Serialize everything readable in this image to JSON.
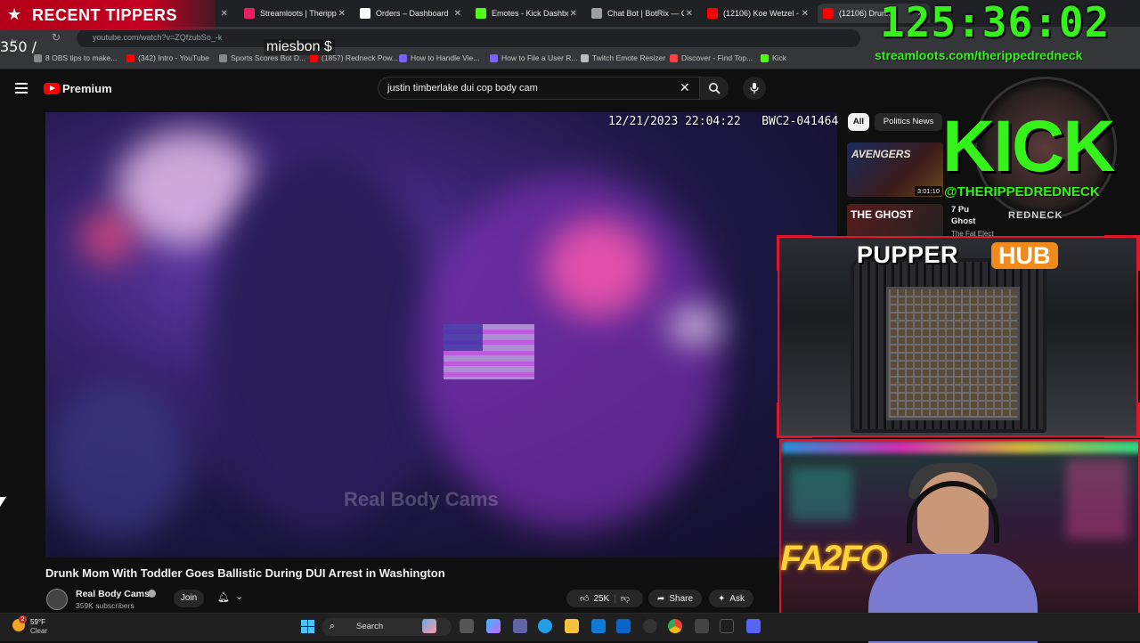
{
  "browser": {
    "tabs": [
      {
        "label": "",
        "color": "#c0392b"
      },
      {
        "label": "Streamloots | Therippe",
        "color": "#e91e63"
      },
      {
        "label": "Orders – Dashboard",
        "color": "#ffffff"
      },
      {
        "label": "Emotes - Kick Dashbo",
        "color": "#53fc18"
      },
      {
        "label": "Chat Bot | BotRix — Cl",
        "color": "#9aa0a6"
      },
      {
        "label": "(12106) Koe Wetzel - S",
        "color": "#ff0000"
      },
      {
        "label": "(12106) Drunk",
        "color": "#ff0000"
      }
    ],
    "url": "youtube.com/watch?v=ZQfzubSo_-k",
    "bookmarks": [
      {
        "label": "8 OBS tips to make...",
        "color": "#888888"
      },
      {
        "label": "(342) Intro - YouTube",
        "color": "#ff0000"
      },
      {
        "label": "Sports Scores Bot D...",
        "color": "#888888"
      },
      {
        "label": "(1857) Redneck Pow...",
        "color": "#ff0000"
      },
      {
        "label": "How to Handle Vie...",
        "color": "#7b61ff"
      },
      {
        "label": "How to File a User R...",
        "color": "#7b61ff"
      },
      {
        "label": "Twitch Emote Resizer",
        "color": "#bbbbbb"
      },
      {
        "label": "Discover - Find Top...",
        "color": "#ff4040"
      },
      {
        "label": "Kick",
        "color": "#53fc18"
      }
    ]
  },
  "youtube": {
    "brand": "Premium",
    "search_query": "justin timberlake dui cop body cam",
    "player": {
      "timestamp": "12/21/2023 22:04:22",
      "camera_id": "BWC2-041464",
      "watermark": "Real Body Cams"
    },
    "video_title": "Drunk Mom With Toddler Goes Ballistic During DUI Arrest in Washington",
    "channel": {
      "name": "Real Body Cams",
      "subscribers": "359K subscribers"
    },
    "join_label": "Join",
    "likes": "25K",
    "share_label": "Share",
    "ask_label": "Ask",
    "chips": [
      "All",
      "Politics News"
    ],
    "recommendations": [
      {
        "thumb_text": "AVENGERS",
        "duration": "3:01:10"
      },
      {
        "thumb_text": "THE GHOST",
        "title_lines": [
          "7 Pu",
          "Ghost"
        ],
        "channel": "The Fat Elect"
      }
    ]
  },
  "overlay": {
    "recent_tippers_label": "RECENT TIPPERS",
    "ticker_text": "350 /",
    "ticker_name": "miesbon $",
    "timer": "125:36:02",
    "timer_url": "streamloots.com/therippedredneck",
    "kick_logo": "KICK",
    "kick_handle": "@THERIPPEDREDNECK",
    "kick_subtext": "REDNECK",
    "pupper_text": "PUPPER",
    "hub_text": "HUB",
    "cam_sign": "FA2FO",
    "accent_green": "#35f21a",
    "accent_red": "#e0162b"
  },
  "taskbar": {
    "weather_badge": "2",
    "weather_temp": "59°F",
    "weather_cond": "Clear",
    "search_placeholder": "Search"
  }
}
